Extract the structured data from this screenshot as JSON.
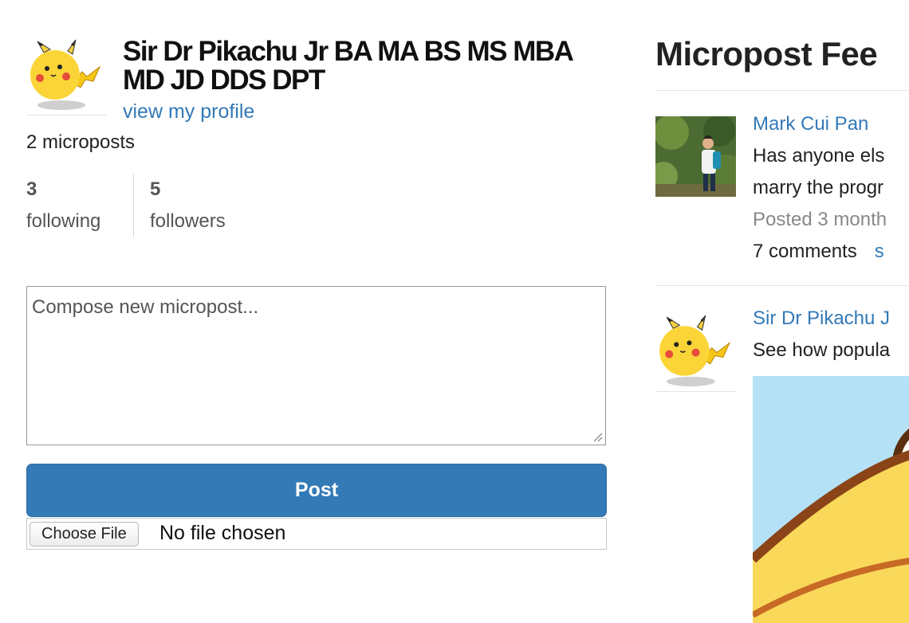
{
  "user": {
    "name": "Sir Dr Pikachu Jr BA MA BS MS MBA MD JD DDS DPT",
    "profile_link": "view my profile",
    "micropost_count": "2 microposts"
  },
  "stats": {
    "following_count": "3",
    "following_label": "following",
    "followers_count": "5",
    "followers_label": "followers"
  },
  "compose": {
    "placeholder": "Compose new micropost...",
    "post_label": "Post",
    "choose_file_label": "Choose File",
    "file_status": "No file chosen"
  },
  "feed": {
    "title": "Micropost Fee",
    "items": [
      {
        "author": "Mark Cui Pan",
        "lines": [
          "Has anyone els",
          "marry the progr"
        ],
        "posted": "Posted 3 month",
        "comments": "7 comments",
        "link": "s"
      },
      {
        "author": "Sir Dr Pikachu J",
        "lines": [
          "See how popula"
        ]
      }
    ]
  },
  "colors": {
    "link": "#337ab7",
    "primary_button": "#337ab7",
    "muted_text": "#888888"
  },
  "icons": [
    "pikachu-avatar",
    "user-photo",
    "resize-grip-icon"
  ]
}
